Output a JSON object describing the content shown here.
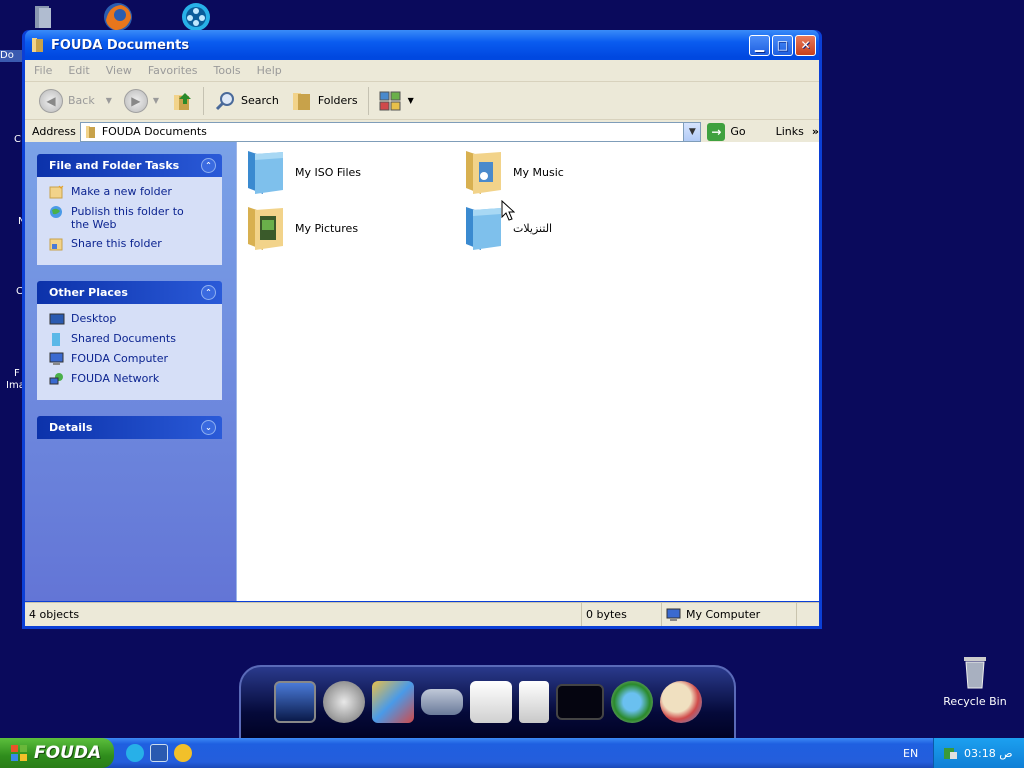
{
  "desktop": {
    "left_fragments": [
      "Do",
      "C",
      "N",
      "C",
      "F",
      "Ima"
    ],
    "recycle_bin_label": "Recycle Bin"
  },
  "window": {
    "title": "FOUDA Documents",
    "menu": [
      "File",
      "Edit",
      "View",
      "Favorites",
      "Tools",
      "Help"
    ],
    "toolbar": {
      "back": "Back",
      "search": "Search",
      "folders": "Folders"
    },
    "address": {
      "label": "Address",
      "value": "FOUDA Documents",
      "go": "Go",
      "links": "Links"
    },
    "taskpane": {
      "file_tasks": {
        "title": "File and Folder Tasks",
        "items": [
          "Make a new folder",
          "Publish this folder to the Web",
          "Share this folder"
        ]
      },
      "other_places": {
        "title": "Other Places",
        "items": [
          "Desktop",
          "Shared Documents",
          "FOUDA Computer",
          "FOUDA Network"
        ]
      },
      "details": {
        "title": "Details"
      }
    },
    "files": [
      {
        "name": "My ISO Files",
        "icon": "folder-blue-icon"
      },
      {
        "name": "My Music",
        "icon": "folder-music-icon"
      },
      {
        "name": "My Pictures",
        "icon": "folder-pictures-icon"
      },
      {
        "name": "التنزيلات",
        "icon": "folder-blue-icon"
      }
    ],
    "status": {
      "objects": "4 objects",
      "size": "0 bytes",
      "zone": "My Computer"
    }
  },
  "taskbar": {
    "start_label": "FOUDA",
    "lang": "EN",
    "clock": "03:18 ص"
  }
}
